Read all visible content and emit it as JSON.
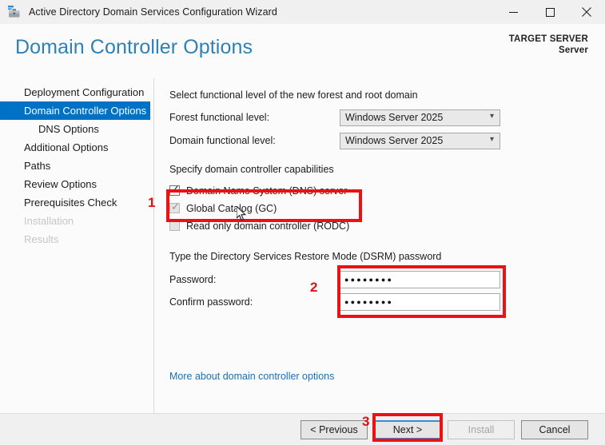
{
  "window": {
    "title": "Active Directory Domain Services Configuration Wizard",
    "icon": "ad-wizard-icon",
    "controls": {
      "minimize": "minimize-icon",
      "maximize": "maximize-icon",
      "close": "close-icon"
    }
  },
  "header": {
    "page_title": "Domain Controller Options",
    "target_server_label": "TARGET SERVER",
    "target_server_name": "Server",
    "title_color": "#2f80b5"
  },
  "sidebar": {
    "items": [
      {
        "label": "Deployment Configuration",
        "state": "normal",
        "indent": false
      },
      {
        "label": "Domain Controller Options",
        "state": "selected",
        "indent": false
      },
      {
        "label": "DNS Options",
        "state": "normal",
        "indent": true
      },
      {
        "label": "Additional Options",
        "state": "normal",
        "indent": false
      },
      {
        "label": "Paths",
        "state": "normal",
        "indent": false
      },
      {
        "label": "Review Options",
        "state": "normal",
        "indent": false
      },
      {
        "label": "Prerequisites Check",
        "state": "normal",
        "indent": false
      },
      {
        "label": "Installation",
        "state": "disabled",
        "indent": false
      },
      {
        "label": "Results",
        "state": "disabled",
        "indent": false
      }
    ],
    "selected_color": "#0072c6"
  },
  "main": {
    "functional_level": {
      "heading": "Select functional level of the new forest and root domain",
      "forest_label": "Forest functional level:",
      "forest_value": "Windows Server 2025",
      "domain_label": "Domain functional level:",
      "domain_value": "Windows Server 2025",
      "chevron": "chevron-down-icon"
    },
    "capabilities": {
      "heading": "Specify domain controller capabilities",
      "items": [
        {
          "label": "Domain Name System (DNS) server",
          "checked": true,
          "enabled": true
        },
        {
          "label": "Global Catalog (GC)",
          "checked": true,
          "enabled": false
        },
        {
          "label": "Read only domain controller (RODC)",
          "checked": false,
          "enabled": false
        }
      ]
    },
    "dsrm": {
      "heading": "Type the Directory Services Restore Mode (DSRM) password",
      "password_label": "Password:",
      "password_value": "●●●●●●●●",
      "confirm_label": "Confirm password:",
      "confirm_value": "●●●●●●●●"
    },
    "more_link": "More about domain controller options"
  },
  "footer": {
    "previous": "< Previous",
    "next": "Next >",
    "install": "Install",
    "cancel": "Cancel"
  },
  "annotations": {
    "marker_color": "#ee1111",
    "items": [
      {
        "number": "1",
        "target": "domain-controller-capabilities"
      },
      {
        "number": "2",
        "target": "dsrm-password-fields"
      },
      {
        "number": "3",
        "target": "next-button"
      }
    ]
  }
}
